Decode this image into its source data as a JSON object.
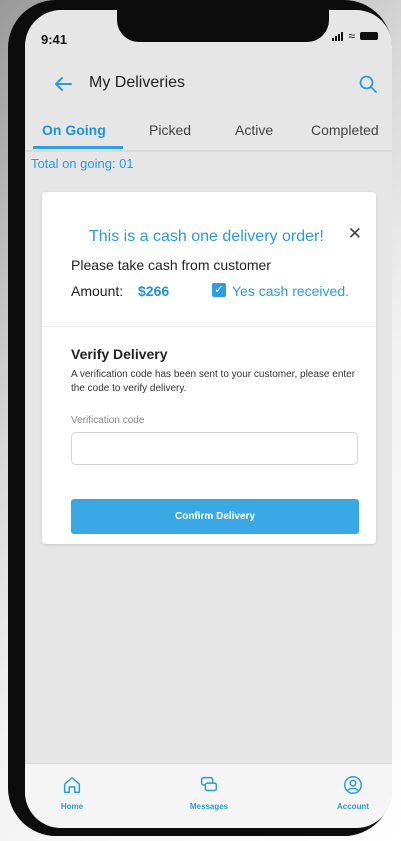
{
  "status": {
    "time": "9:41"
  },
  "header": {
    "title": "My Deliveries"
  },
  "tabs": [
    {
      "label": "On Going"
    },
    {
      "label": "Picked"
    },
    {
      "label": "Active"
    },
    {
      "label": "Completed"
    }
  ],
  "summary": {
    "total": "Total on going: 01"
  },
  "dialog": {
    "title": "This is a cash one delivery order!",
    "close": "✕",
    "instruction": "Please take cash from customer",
    "amount_label": "Amount:",
    "amount_value": "$266",
    "cash_received": {
      "checked": true,
      "label": "Yes cash received."
    }
  },
  "verify": {
    "title": "Verify Delivery",
    "description": "A verification code has been sent to your customer, please enter the code to verify delivery.",
    "code_label": "Verification code",
    "code_value": "",
    "confirm_label": "Confirm Delivery"
  },
  "bottom_nav": [
    {
      "label": "Home",
      "icon": "home-icon"
    },
    {
      "label": "Messages",
      "icon": "messages-icon"
    },
    {
      "label": "Account",
      "icon": "account-icon"
    }
  ],
  "colors": {
    "accent": "#2a9be0",
    "button": "#3ba8e6"
  }
}
